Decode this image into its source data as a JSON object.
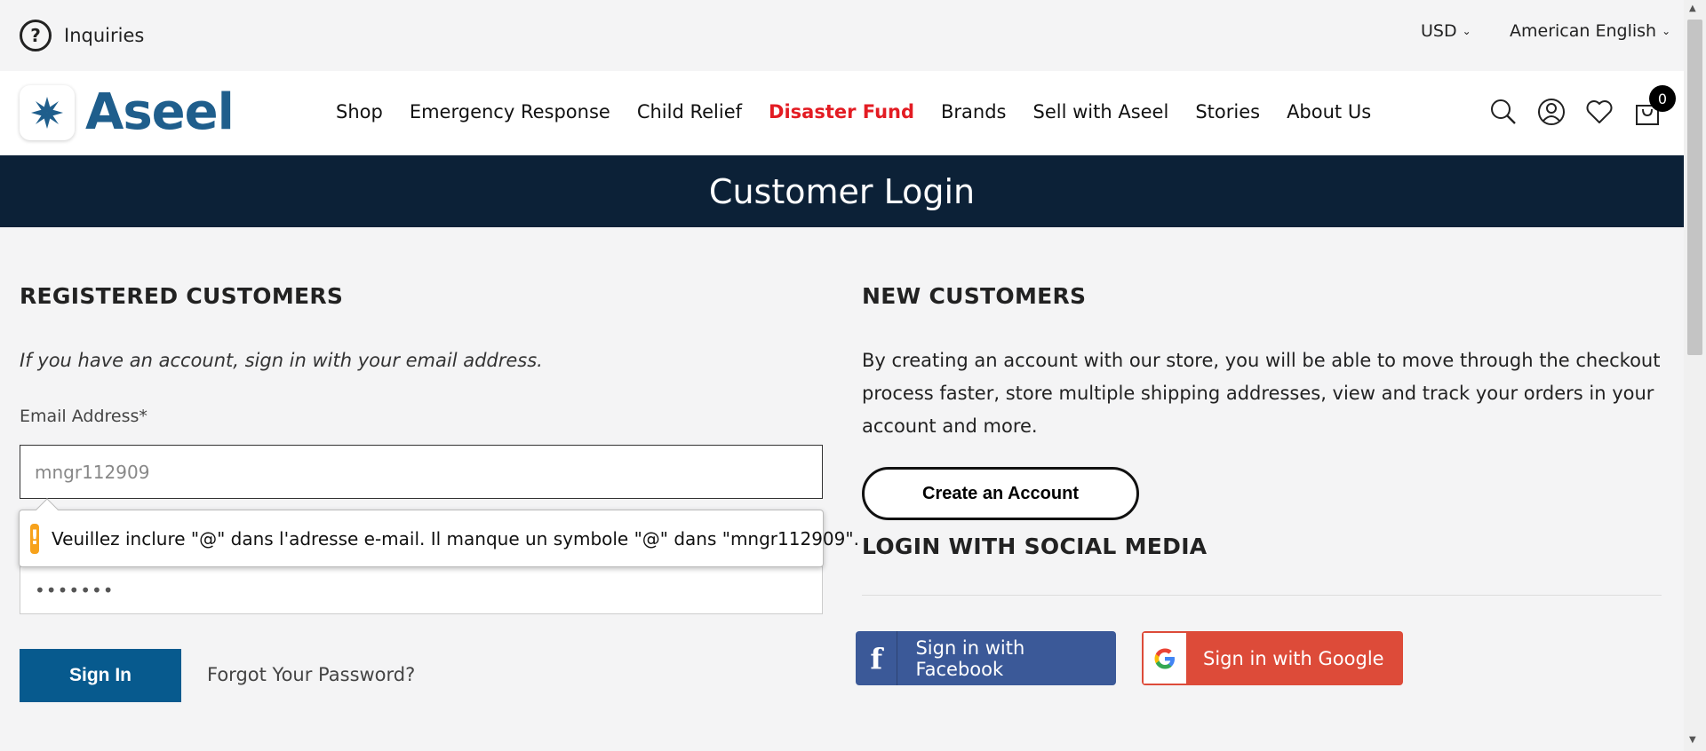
{
  "topbar": {
    "inquiries_label": "Inquiries",
    "currency": "USD",
    "language": "American English"
  },
  "header": {
    "logo_text": "Aseel",
    "nav": [
      {
        "label": "Shop"
      },
      {
        "label": "Emergency Response"
      },
      {
        "label": "Child Relief"
      },
      {
        "label": "Disaster Fund"
      },
      {
        "label": "Brands"
      },
      {
        "label": "Sell with Aseel"
      },
      {
        "label": "Stories"
      },
      {
        "label": "About Us"
      }
    ],
    "cart_count": "0",
    "highlight_color": "#e31c23"
  },
  "banner": {
    "title": "Customer Login"
  },
  "registered": {
    "title": "REGISTERED CUSTOMERS",
    "intro": "If you have an account, sign in with your email address.",
    "email_label": "Email Address*",
    "email_value": "mngr112909",
    "password_value": "•••••••",
    "tooltip": "Veuillez inclure \"@\" dans l'adresse e-mail. Il manque un symbole \"@\" dans \"mngr112909\".",
    "signin_label": "Sign In",
    "forgot_label": "Forgot Your Password?"
  },
  "new_customers": {
    "title": "NEW CUSTOMERS",
    "description": "By creating an account with our store, you will be able to move through the checkout process faster, store multiple shipping addresses, view and track your orders in your account and more.",
    "create_label": "Create an Account"
  },
  "social": {
    "title": "LOGIN WITH SOCIAL MEDIA",
    "facebook_label": "Sign in with Facebook",
    "google_label": "Sign in with Google"
  },
  "colors": {
    "banner": "#0c2137",
    "primary_button": "#075a8e",
    "facebook": "#3b5998",
    "google": "#dd4b39"
  }
}
